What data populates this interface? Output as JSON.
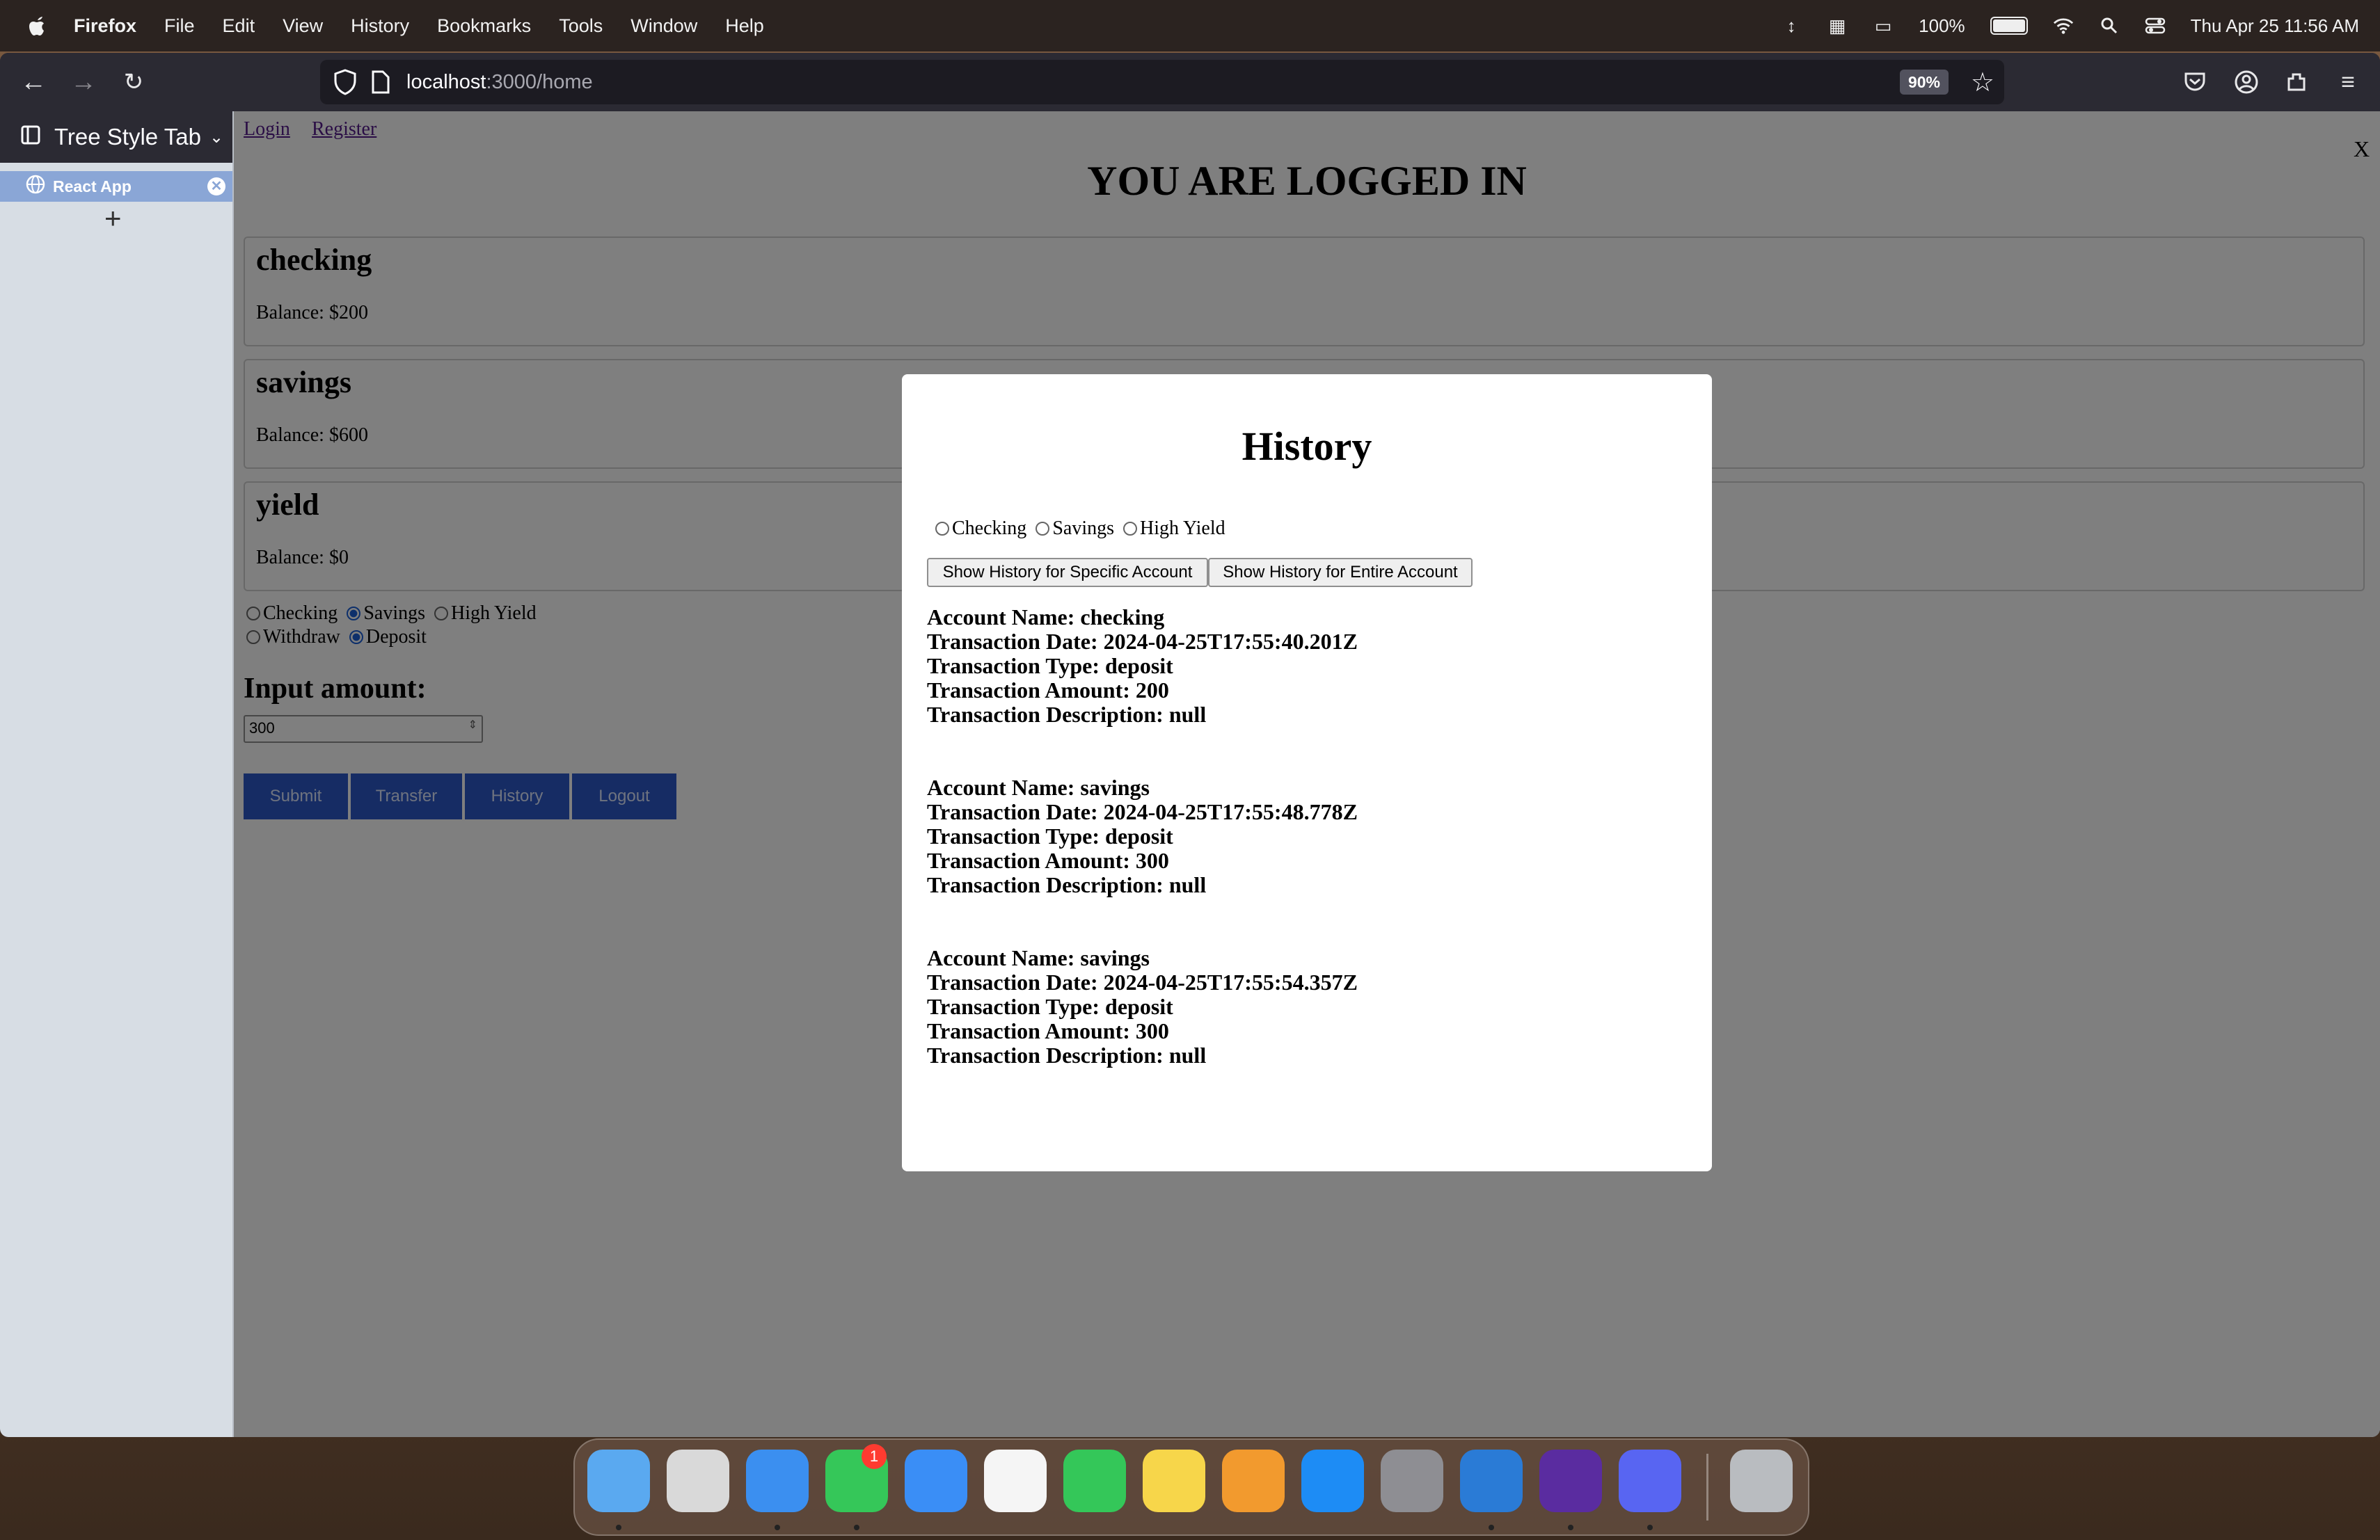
{
  "menubar": {
    "app_name": "Firefox",
    "menus": [
      "File",
      "Edit",
      "View",
      "History",
      "Bookmarks",
      "Tools",
      "Window",
      "Help"
    ],
    "battery": "100%",
    "clock": "Thu Apr 25  11:56 AM"
  },
  "browser": {
    "url_host": "localhost",
    "url_path": ":3000/home",
    "zoom": "90%"
  },
  "sidebar": {
    "title": "Tree Style Tab",
    "tab_label": "React App",
    "new_tab": "+"
  },
  "page": {
    "login_link": "Login",
    "register_link": "Register",
    "close_label": "X",
    "heading": "YOU ARE LOGGED IN",
    "accounts": [
      {
        "name": "checking",
        "balance": "Balance: $200"
      },
      {
        "name": "savings",
        "balance": "Balance: $600"
      },
      {
        "name": "yield",
        "balance": "Balance: $0"
      }
    ],
    "account_radios": [
      "Checking",
      "Savings",
      "High Yield"
    ],
    "account_selected": "Savings",
    "action_radios": [
      "Withdraw",
      "Deposit"
    ],
    "action_selected": "Deposit",
    "input_label": "Input amount:",
    "input_value": "300",
    "buttons": [
      "Submit",
      "Transfer",
      "History",
      "Logout"
    ]
  },
  "modal": {
    "title": "History",
    "radios": [
      "Checking",
      "Savings",
      "High Yield"
    ],
    "btn_specific": "Show History for Specific Account",
    "btn_entire": "Show History for Entire Account",
    "transactions": [
      {
        "name": "Account Name: checking",
        "date": "Transaction Date: 2024-04-25T17:55:40.201Z",
        "type": "Transaction Type: deposit",
        "amount": "Transaction Amount: 200",
        "desc": "Transaction Description: null"
      },
      {
        "name": "Account Name: savings",
        "date": "Transaction Date: 2024-04-25T17:55:48.778Z",
        "type": "Transaction Type: deposit",
        "amount": "Transaction Amount: 300",
        "desc": "Transaction Description: null"
      },
      {
        "name": "Account Name: savings",
        "date": "Transaction Date: 2024-04-25T17:55:54.357Z",
        "type": "Transaction Type: deposit",
        "amount": "Transaction Amount: 300",
        "desc": "Transaction Description: null"
      }
    ]
  },
  "dock": {
    "apps": [
      "finder-icon",
      "launchpad-icon",
      "safari-icon",
      "messages-icon",
      "mail-icon",
      "photos-icon",
      "facetime-icon",
      "notes-icon",
      "pages-icon",
      "app-store-icon",
      "system-settings-icon",
      "vscode-icon",
      "firefox-icon",
      "discord-icon",
      "trash-icon"
    ],
    "messages_badge": "1",
    "colors": [
      "#5aa9f0",
      "#d9d9d9",
      "#3b8ff0",
      "#35c759",
      "#3a8ef6",
      "#f5f5f5",
      "#34c759",
      "#f7d64a",
      "#f29a2e",
      "#1d8cf5",
      "#8e8e93",
      "#2a7bd6",
      "#5a2ca0",
      "#5865f2",
      "#b9bcc0"
    ]
  }
}
